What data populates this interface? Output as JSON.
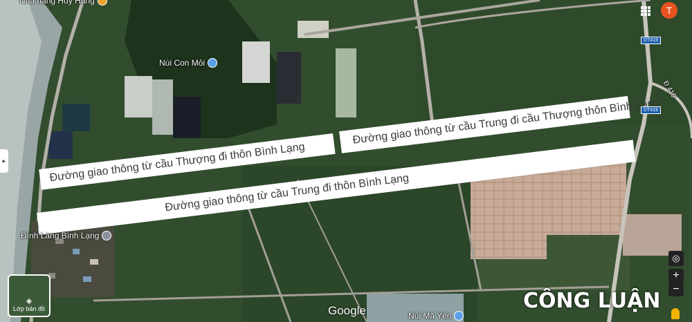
{
  "labels": {
    "road_left": "Đường giao thông từ cầu Thượng đi thôn Bình Lạng",
    "road_right": "Đường giao thông từ cầu Trung đi cầu Thượng thôn Bình Lạng",
    "road_long": "Đường giao thông từ cầu Trung đi thôn Bình Lạng"
  },
  "places": {
    "top_left": "Nhà hàng Huy Hùng",
    "nui_con_moi": "Núi Con Mỏi",
    "dinh_lang": "Đình Làng Bình Lạng",
    "nui_ma_yen": "Núi Mã Yên"
  },
  "road_shields": {
    "dt419_top": "DT419",
    "dt419_mid": "DT419",
    "dt419_curve": "Đ 419"
  },
  "ui": {
    "layer_button_label": "Lớp bản đồ",
    "google_logo": "Google",
    "account_initial": "T",
    "watermark": "CÔNG LUẬN",
    "zoom_in": "+",
    "zoom_out": "−"
  },
  "icons": [
    "apps-grid-icon",
    "account-avatar-icon",
    "layers-icon",
    "locate-icon",
    "pegman-icon",
    "camera-poi-icon",
    "pin-icon"
  ]
}
